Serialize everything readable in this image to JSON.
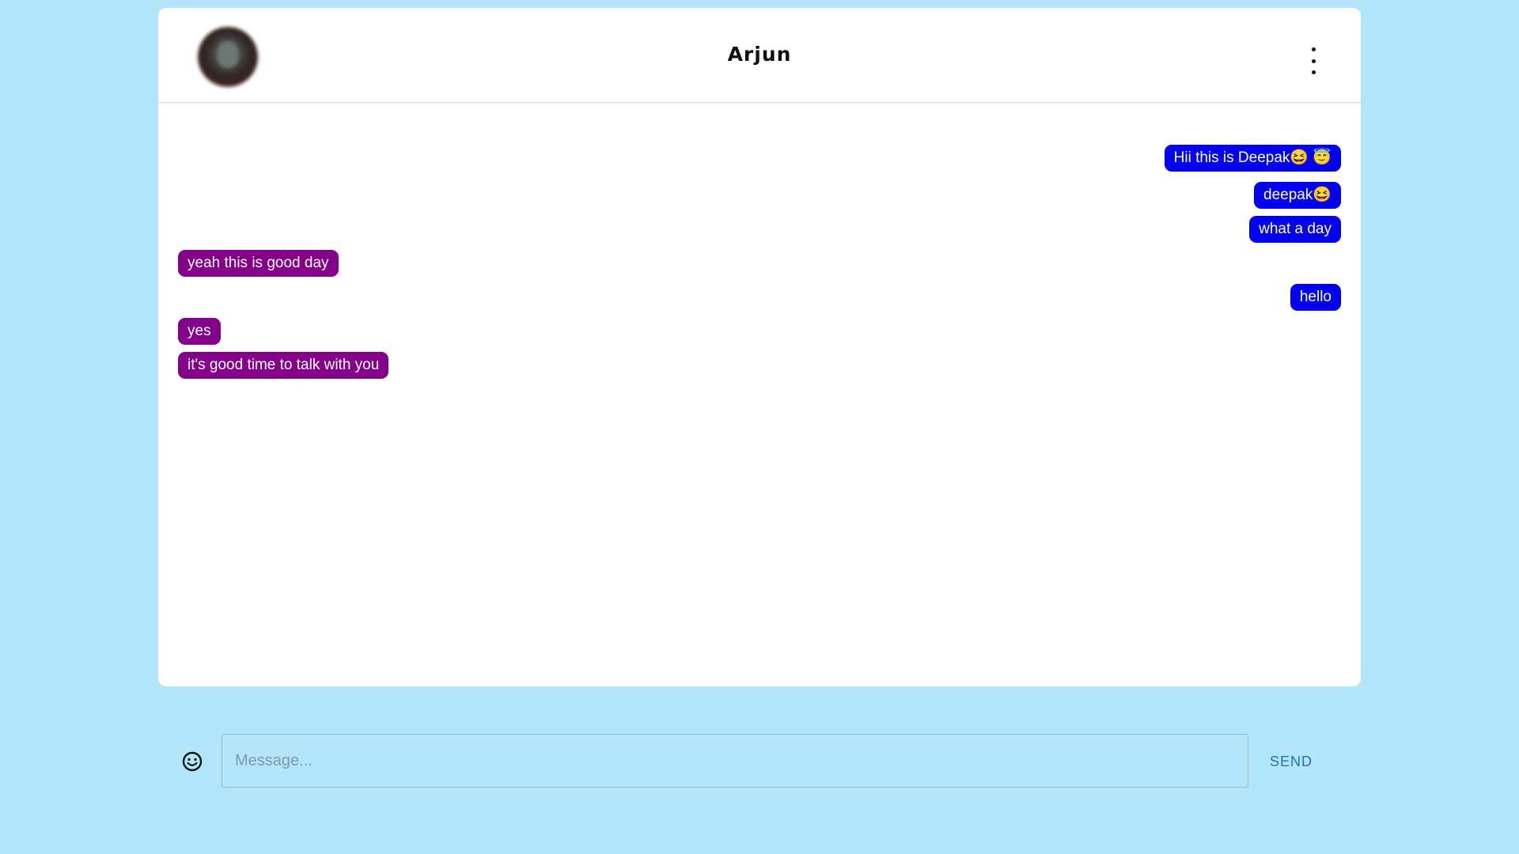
{
  "header": {
    "contact_name": "Arjun",
    "menu_icon": "more-vertical-icon"
  },
  "messages": [
    {
      "direction": "sent",
      "text": "Hii this is Deepak😆 😇"
    },
    {
      "direction": "sent",
      "text": "deepak😆"
    },
    {
      "direction": "sent",
      "text": "what a day"
    },
    {
      "direction": "received",
      "text": "yeah this is good day"
    },
    {
      "direction": "sent",
      "text": "hello"
    },
    {
      "direction": "received",
      "text": "yes"
    },
    {
      "direction": "received",
      "text": "it's good time to talk with you"
    }
  ],
  "composer": {
    "emoji_icon": "smiley-face-icon",
    "input_value": "",
    "input_placeholder": "Message...",
    "send_label": "SEND"
  },
  "colors": {
    "background": "#b3e5fb",
    "sent_bubble": "#0202ef",
    "received_bubble": "#84018a",
    "send_button": "#1e70c0"
  }
}
